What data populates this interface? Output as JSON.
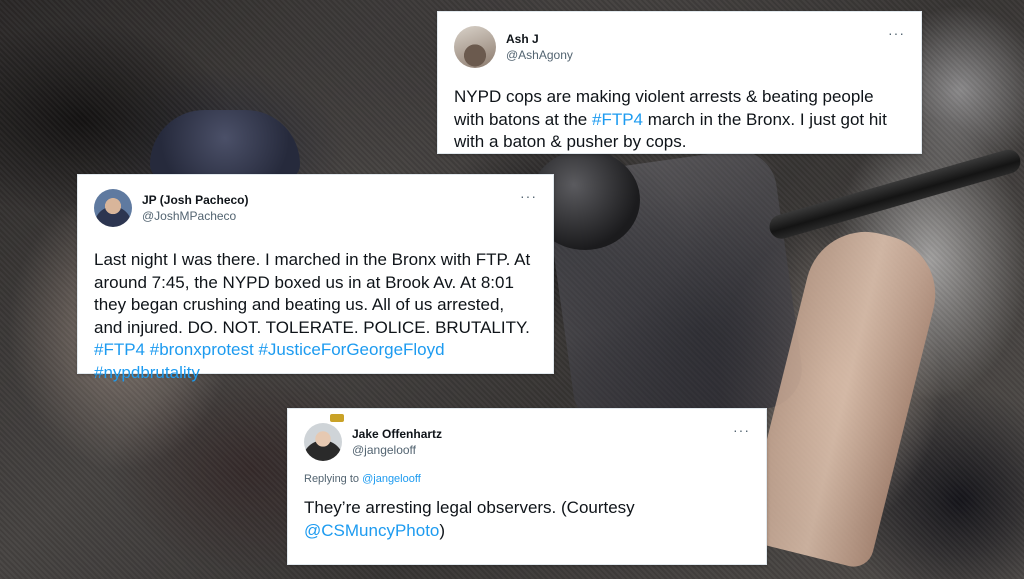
{
  "tweets": [
    {
      "display_name": "Ash J",
      "handle": "@AshAgony",
      "more": "···",
      "body_pre": "NYPD cops are making violent arrests & beating people with batons at the ",
      "hashtag1": "#FTP4",
      "body_post": " march in the Bronx. I just got hit with a baton & pusher by cops."
    },
    {
      "display_name": "JP (Josh Pacheco)",
      "handle": "@JoshMPacheco",
      "more": "···",
      "body_pre": "Last night I was there. I marched in the Bronx with FTP. At around 7:45, the NYPD boxed us in at Brook Av. At 8:01 they began crushing and beating us. All of us arrested, and injured. DO. NOT. TOLERATE. POLICE. BRUTALITY. ",
      "hashtags": [
        "#FTP4",
        "#bronxprotest",
        "#JusticeForGeorgeFloyd",
        "#nypdbrutality"
      ]
    },
    {
      "display_name": "Jake Offenhartz",
      "handle": "@jangelooff",
      "more": "···",
      "replying_prefix": "Replying to ",
      "replying_to": "@jangelooff",
      "body_pre": "They’re arresting legal observers. (Courtesy ",
      "mention": "@CSMuncyPhoto",
      "body_post": ")"
    }
  ]
}
